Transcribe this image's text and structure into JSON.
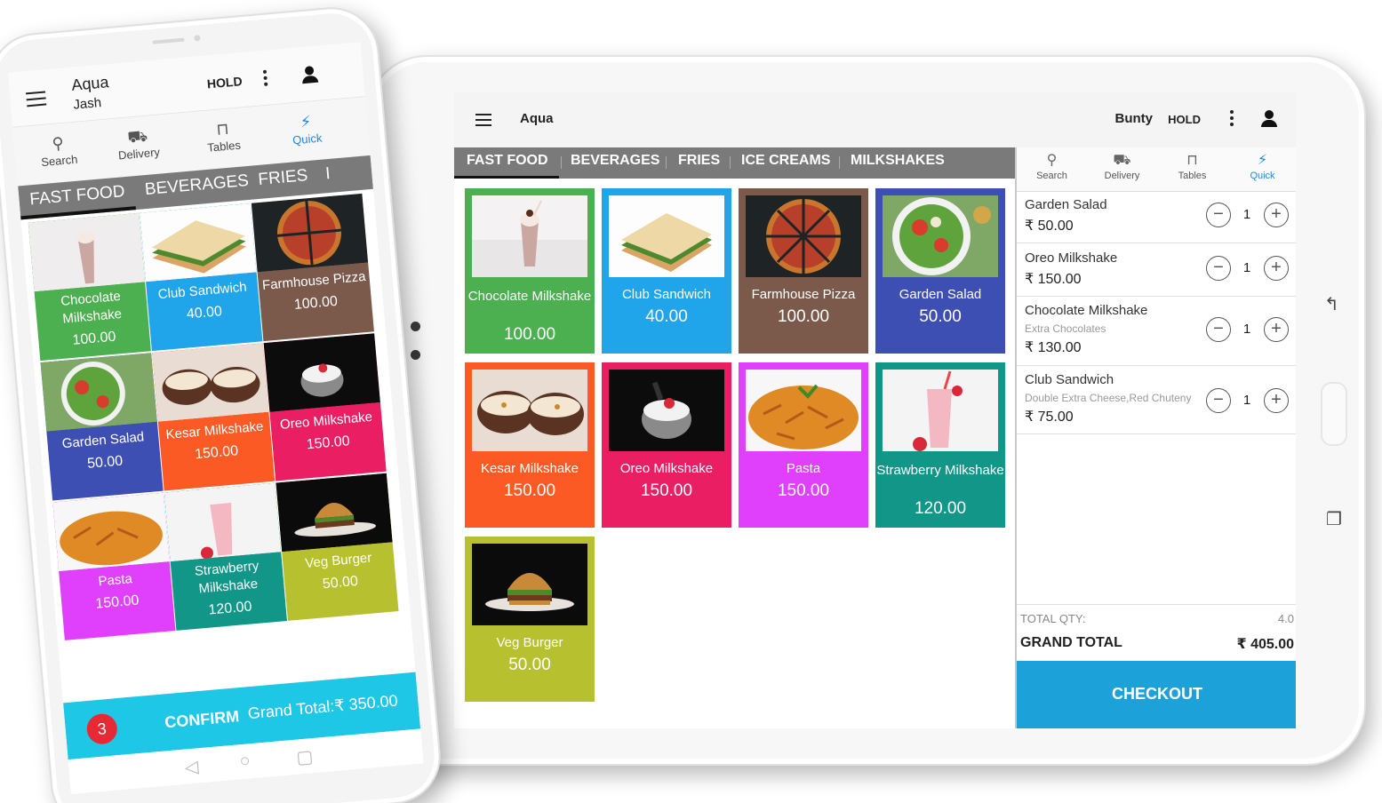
{
  "colors": {
    "green": "#4caf50",
    "blue": "#20a4ea",
    "brown": "#7b5a4b",
    "indigo": "#3e4fb4",
    "orange": "#fb5a24",
    "pink": "#e91e63",
    "magenta": "#e040fb",
    "teal": "#119688",
    "olive": "#b7c12f",
    "checkout": "#1ca1d8",
    "confirm": "#1ec7e6",
    "badge": "#e52a36",
    "active_tab": "#1e88e5",
    "category_bar": "#7a7a7a"
  },
  "tablet": {
    "title": "Aqua",
    "user": "Bunty",
    "hold_label": "HOLD",
    "categories": [
      "FAST FOOD",
      "BEVERAGES",
      "FRIES",
      "ICE CREAMS",
      "MILKSHAKES"
    ],
    "items": [
      {
        "name": "Chocolate Milkshake",
        "price": "100.00",
        "color": "green",
        "icon": "milkshake-image"
      },
      {
        "name": "Club Sandwich",
        "price": "40.00",
        "color": "blue",
        "icon": "sandwich-image"
      },
      {
        "name": "Farmhouse Pizza",
        "price": "100.00",
        "color": "brown",
        "icon": "pizza-image"
      },
      {
        "name": "Garden Salad",
        "price": "50.00",
        "color": "indigo",
        "icon": "salad-image"
      },
      {
        "name": "Kesar Milkshake",
        "price": "150.00",
        "color": "orange",
        "icon": "kesar-milkshake-image"
      },
      {
        "name": "Oreo Milkshake",
        "price": "150.00",
        "color": "pink",
        "icon": "oreo-milkshake-image"
      },
      {
        "name": "Pasta",
        "price": "150.00",
        "color": "magenta",
        "icon": "pasta-image"
      },
      {
        "name": "Strawberry Milkshake",
        "price": "120.00",
        "color": "teal",
        "icon": "strawberry-milkshake-image"
      },
      {
        "name": "Veg Burger",
        "price": "50.00",
        "color": "olive",
        "icon": "burger-image"
      }
    ],
    "cart_tabs": [
      {
        "label": "Search",
        "icon": "search-icon"
      },
      {
        "label": "Delivery",
        "icon": "delivery-icon"
      },
      {
        "label": "Tables",
        "icon": "tables-icon"
      },
      {
        "label": "Quick",
        "icon": "quick-icon"
      }
    ],
    "cart": [
      {
        "name": "Garden Salad",
        "note": "",
        "price": "₹ 50.00",
        "qty": "1"
      },
      {
        "name": "Oreo Milkshake",
        "note": "",
        "price": "₹ 150.00",
        "qty": "1"
      },
      {
        "name": "Chocolate Milkshake",
        "note": "Extra Chocolates",
        "price": "₹ 130.00",
        "qty": "1"
      },
      {
        "name": "Club Sandwich",
        "note": "Double Extra Cheese,Red Chuteny",
        "price": "₹ 75.00",
        "qty": "1"
      }
    ],
    "total_qty_label": "TOTAL QTY:",
    "total_qty": "4.0",
    "grand_total_label": "GRAND TOTAL",
    "grand_total": "₹ 405.00",
    "checkout_label": "CHECKOUT"
  },
  "phone": {
    "title": "Aqua",
    "user": "Jash",
    "hold_label": "HOLD",
    "tabs": [
      "Search",
      "Delivery",
      "Tables",
      "Quick"
    ],
    "categories": [
      "FAST FOOD",
      "BEVERAGES",
      "FRIES",
      "I"
    ],
    "items": [
      {
        "name": "Chocolate Milkshake",
        "price": "100.00",
        "color": "green"
      },
      {
        "name": "Club Sandwich",
        "price": "40.00",
        "color": "blue"
      },
      {
        "name": "Farmhouse Pizza",
        "price": "100.00",
        "color": "brown"
      },
      {
        "name": "Garden Salad",
        "price": "50.00",
        "color": "indigo"
      },
      {
        "name": "Kesar Milkshake",
        "price": "150.00",
        "color": "orange"
      },
      {
        "name": "Oreo Milkshake",
        "price": "150.00",
        "color": "pink"
      },
      {
        "name": "Pasta",
        "price": "150.00",
        "color": "magenta"
      },
      {
        "name": "Strawberry Milkshake",
        "price": "120.00",
        "color": "teal"
      },
      {
        "name": "Veg Burger",
        "price": "50.00",
        "color": "olive"
      }
    ],
    "badge_count": "3",
    "confirm_label": "CONFIRM",
    "grand_total_text": "Grand Total:₹ 350.00"
  }
}
